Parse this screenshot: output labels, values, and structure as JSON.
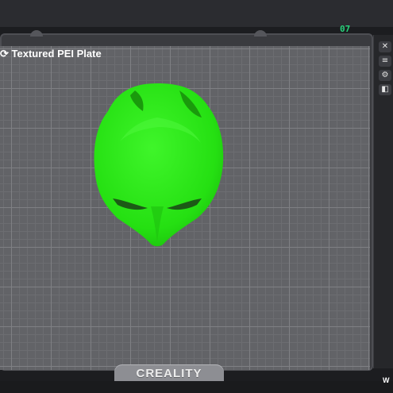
{
  "viewport": {
    "plate_name": "Textured PEI Plate",
    "plate_number": "07",
    "brand": "CREALITY",
    "corner_text": "W"
  },
  "toolbar": {
    "icons": [
      "close-icon",
      "layers-icon",
      "settings-icon",
      "view-icon"
    ]
  },
  "model": {
    "color": "#2ef21a",
    "shape": "mask"
  },
  "colors": {
    "plate": "#626367",
    "grid": "#7f8084",
    "background": "#1c1d20"
  }
}
